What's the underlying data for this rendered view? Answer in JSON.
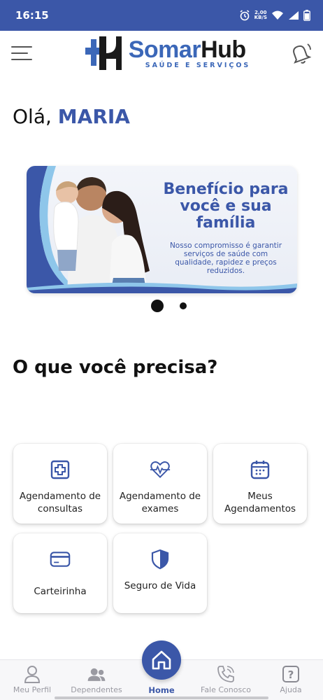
{
  "status_bar": {
    "time": "16:15",
    "speed_value": "2,00",
    "speed_unit": "KB/S",
    "icons": [
      "alarm-icon",
      "wifi-icon",
      "signal-icon",
      "battery-icon"
    ]
  },
  "header": {
    "menu_icon": "menu-icon",
    "logo_name_part1": "Somar",
    "logo_name_part2": "Hub",
    "logo_subtitle": "SAÚDE E SERVIÇOS",
    "bell_icon": "bell-icon"
  },
  "greeting": {
    "prefix": "Olá,",
    "name": "MARIA"
  },
  "banner": {
    "title": "Benefício para você e sua família",
    "text": "Nosso compromisso é garantir serviços de saúde com qualidade, rapidez e preços reduzidos.",
    "slide_count": 2,
    "active_slide": 1
  },
  "section_title": "O que você precisa?",
  "services": [
    {
      "label": "Agendamento de consultas",
      "icon": "medical-cross-icon"
    },
    {
      "label": "Agendamento de exames",
      "icon": "heartbeat-icon"
    },
    {
      "label": "Meus Agendamentos",
      "icon": "calendar-icon"
    },
    {
      "label": "Carteirinha",
      "icon": "card-icon"
    },
    {
      "label": "Seguro de Vida",
      "icon": "shield-icon"
    }
  ],
  "bottom_nav": {
    "items": [
      {
        "label": "Meu Perfil",
        "icon": "user-icon"
      },
      {
        "label": "Dependentes",
        "icon": "users-icon"
      },
      {
        "label": "Home",
        "icon": "home-icon",
        "active": true
      },
      {
        "label": "Fale Conosco",
        "icon": "phone-icon"
      },
      {
        "label": "Ajuda",
        "icon": "help-icon"
      }
    ]
  },
  "colors": {
    "brand": "#3b57a8",
    "brand_light": "#3b67b8",
    "nav_inactive": "#9a9aa2"
  }
}
